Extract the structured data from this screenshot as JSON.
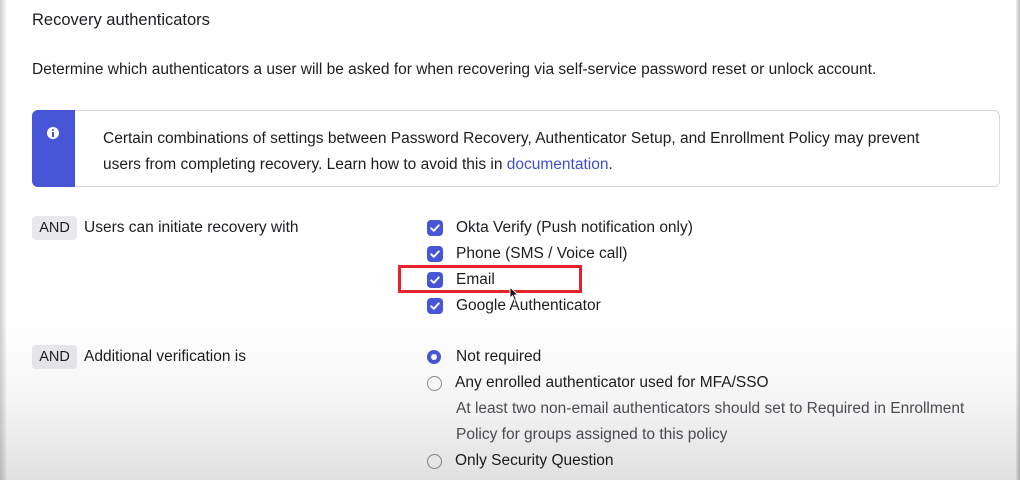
{
  "section": {
    "title": "Recovery authenticators",
    "description": "Determine which authenticators a user will be asked for when recovering via self-service password reset or unlock account."
  },
  "callout": {
    "icon": "info-icon",
    "text_line1": "Certain combinations of settings between Password Recovery, Authenticator Setup, and Enrollment Policy may prevent",
    "text_line2": "users from completing recovery. Learn how to avoid this in ",
    "link_text": "documentation",
    "text_end": ".",
    "accent_color": "#4756d6"
  },
  "recovery_methods": {
    "badge": "AND",
    "label": "Users can initiate recovery with",
    "options": [
      {
        "label": "Okta Verify (Push notification only)",
        "checked": true
      },
      {
        "label": "Phone (SMS / Voice call)",
        "checked": true
      },
      {
        "label": "Email",
        "checked": true
      },
      {
        "label": "Google Authenticator",
        "checked": true
      }
    ]
  },
  "additional_verification": {
    "badge": "AND",
    "label": "Additional verification is",
    "options": [
      {
        "label": "Not required",
        "selected": true
      },
      {
        "label": "Any enrolled authenticator used for MFA/SSO",
        "selected": false
      },
      {
        "label": "Only Security Question",
        "selected": false
      }
    ],
    "help_line1": "At least two non-email authenticators should set to Required in Enrollment",
    "help_line2": "Policy for groups assigned to this policy"
  },
  "annotation": {
    "highlight_color": "#e8222b"
  }
}
